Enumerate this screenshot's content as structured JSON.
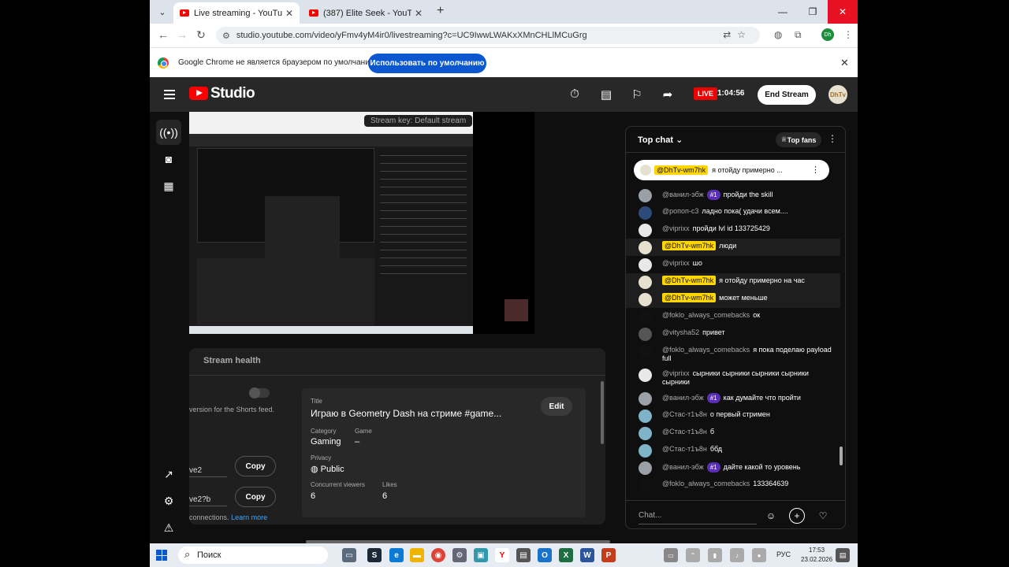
{
  "browser": {
    "tabs": [
      {
        "title": "Live streaming - YouTube Studio",
        "active": true
      },
      {
        "title": "(387) Elite Seek - YouTube",
        "active": false
      }
    ],
    "url": "studio.youtube.com/video/yFmv4yM4ir0/livestreaming?c=UC9IwwLWAKxXMnCHLlMCuGrg",
    "profile_initials": "Dh",
    "infobar": {
      "text": "Google Chrome не является браузером по умолчанию.",
      "button": "Использовать по умолчанию"
    }
  },
  "studio": {
    "logo_text": "Studio",
    "live_label": "LIVE",
    "live_time": "1:04:56",
    "end_stream": "End Stream",
    "avatar_text": "DhTv"
  },
  "preview": {
    "stream_key_label": "Stream key: Default stream"
  },
  "stream_health": {
    "tab_label": "Stream health",
    "shorts_text": "version for the Shorts feed.",
    "url1_fragment": "ve2",
    "url2_fragment": "ve2?b",
    "copy_label": "Copy",
    "connections_text": "connections.",
    "learn_more": "Learn more",
    "info": {
      "title_label": "Title",
      "title_value": "Играю в Geometry Dash на стриме #game...",
      "edit_label": "Edit",
      "category_label": "Category",
      "category_value": "Gaming",
      "game_label": "Game",
      "game_value": "–",
      "privacy_label": "Privacy",
      "privacy_value": "Public",
      "viewers_label": "Concurrent viewers",
      "viewers_value": "6",
      "likes_label": "Likes",
      "likes_value": "6"
    }
  },
  "chat": {
    "title": "Top chat",
    "top_fans": "Top fans",
    "pinned": {
      "author": "@DhTv-wm7hk",
      "text": "я отойду примерно ..."
    },
    "messages": [
      {
        "author": "@ванил-эбж",
        "badge": "#1",
        "text": "пройди the skill",
        "owner": false,
        "color": "#9aa0a6"
      },
      {
        "author": "@ропоп-с3",
        "badge": "",
        "text": "ладно пока( удачи всем....",
        "owner": false,
        "color": "#2d4a7a"
      },
      {
        "author": "@viprixx",
        "badge": "",
        "text": "пройди lvl id 133725429",
        "owner": false,
        "color": "#e8e8e8"
      },
      {
        "author": "@DhTv-wm7hk",
        "badge": "",
        "text": "люди",
        "owner": true,
        "color": "#e5e0d0"
      },
      {
        "author": "@viprixx",
        "badge": "",
        "text": "шо",
        "owner": false,
        "color": "#e8e8e8"
      },
      {
        "author": "@DhTv-wm7hk",
        "badge": "",
        "text": "я отойду примерно на час",
        "owner": true,
        "color": "#e5e0d0"
      },
      {
        "author": "@DhTv-wm7hk",
        "badge": "",
        "text": "может меньше",
        "owner": true,
        "color": "#e5e0d0"
      },
      {
        "author": "@foklo_always_comebacks",
        "badge": "",
        "text": "ок",
        "owner": false,
        "color": "#111111"
      },
      {
        "author": "@vityshа52",
        "badge": "",
        "text": "привет",
        "owner": false,
        "color": "#555555"
      },
      {
        "author": "@foklo_always_comebacks",
        "badge": "",
        "text": "я пока поделаю payload full",
        "owner": false,
        "color": "#111111"
      },
      {
        "author": "@viprixx",
        "badge": "",
        "text": "сырники сырники сырники сырники сырники",
        "owner": false,
        "color": "#e8e8e8"
      },
      {
        "author": "@ванил-эбж",
        "badge": "#1",
        "text": "как думайте что пройти",
        "owner": false,
        "color": "#9aa0a6"
      },
      {
        "author": "@Стас-т1ъ8н",
        "badge": "",
        "text": "о первый стримен",
        "owner": false,
        "color": "#7fb3c8"
      },
      {
        "author": "@Стас-т1ъ8н",
        "badge": "",
        "text": "б",
        "owner": false,
        "color": "#7fb3c8"
      },
      {
        "author": "@Стас-т1ъ8н",
        "badge": "",
        "text": "ббд",
        "owner": false,
        "color": "#7fb3c8"
      },
      {
        "author": "@ванил-эбж",
        "badge": "#1",
        "text": "дайте какой то уровень",
        "owner": false,
        "color": "#9aa0a6"
      },
      {
        "author": "@foklo_always_comebacks",
        "badge": "",
        "text": "133364639",
        "owner": false,
        "color": "#111111"
      }
    ],
    "input_placeholder": "Chat..."
  },
  "taskbar": {
    "search_label": "Поиск",
    "lang": "РУС",
    "time": "17:53",
    "date": "23.02.2026"
  }
}
